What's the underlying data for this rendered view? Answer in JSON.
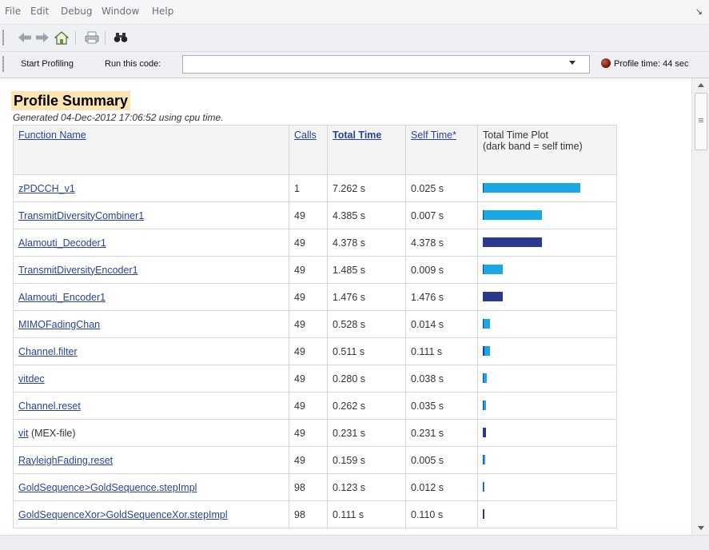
{
  "menu": [
    "File",
    "Edit",
    "Debug",
    "Window",
    "Help"
  ],
  "toolbar": {
    "icons": [
      "back-arrow-icon",
      "forward-arrow-icon",
      "home-icon",
      "print-icon",
      "find-binoculars-icon"
    ]
  },
  "profiler_bar": {
    "start_label": "Start Profiling",
    "run_label": "Run this code:",
    "run_value": "",
    "profile_time": "Profile time: 44 sec"
  },
  "summary": {
    "title": "Profile Summary",
    "generated": "Generated 04-Dec-2012 17:06:52 using cpu time.",
    "headers": {
      "function": "Function Name",
      "calls": "Calls",
      "total": "Total Time",
      "self": "Self Time*",
      "plot_line1": "Total Time Plot",
      "plot_line2": "(dark band = self time)"
    },
    "rows": [
      {
        "name": "zPDCCH_v1",
        "suffix": "",
        "calls": "1",
        "total": "7.262 s",
        "self": "0.025 s",
        "total_s": 7.262,
        "self_s": 0.025
      },
      {
        "name": "TransmitDiversityCombiner1",
        "suffix": "",
        "calls": "49",
        "total": "4.385 s",
        "self": "0.007 s",
        "total_s": 4.385,
        "self_s": 0.007
      },
      {
        "name": "Alamouti_Decoder1",
        "suffix": "",
        "calls": "49",
        "total": "4.378 s",
        "self": "4.378 s",
        "total_s": 4.378,
        "self_s": 4.378
      },
      {
        "name": "TransmitDiversityEncoder1",
        "suffix": "",
        "calls": "49",
        "total": "1.485 s",
        "self": "0.009 s",
        "total_s": 1.485,
        "self_s": 0.009
      },
      {
        "name": "Alamouti_Encoder1",
        "suffix": "",
        "calls": "49",
        "total": "1.476 s",
        "self": "1.476 s",
        "total_s": 1.476,
        "self_s": 1.476
      },
      {
        "name": "MIMOFadingChan",
        "suffix": "",
        "calls": "49",
        "total": "0.528 s",
        "self": "0.014 s",
        "total_s": 0.528,
        "self_s": 0.014
      },
      {
        "name": "Channel.filter",
        "suffix": "",
        "calls": "49",
        "total": "0.511 s",
        "self": "0.111 s",
        "total_s": 0.511,
        "self_s": 0.111
      },
      {
        "name": "vitdec",
        "suffix": "",
        "calls": "49",
        "total": "0.280 s",
        "self": "0.038 s",
        "total_s": 0.28,
        "self_s": 0.038
      },
      {
        "name": "Channel.reset",
        "suffix": "",
        "calls": "49",
        "total": "0.262 s",
        "self": "0.035 s",
        "total_s": 0.262,
        "self_s": 0.035
      },
      {
        "name": "vit",
        "suffix": " (MEX-file)",
        "calls": "49",
        "total": "0.231 s",
        "self": "0.231 s",
        "total_s": 0.231,
        "self_s": 0.231
      },
      {
        "name": "RayleighFading.reset",
        "suffix": "",
        "calls": "49",
        "total": "0.159 s",
        "self": "0.005 s",
        "total_s": 0.159,
        "self_s": 0.005
      },
      {
        "name": "GoldSequence>GoldSequence.stepImpl",
        "suffix": "",
        "calls": "98",
        "total": "0.123 s",
        "self": "0.012 s",
        "total_s": 0.123,
        "self_s": 0.012
      },
      {
        "name": "GoldSequenceXor>GoldSequenceXor.stepImpl",
        "suffix": "",
        "calls": "98",
        "total": "0.111 s",
        "self": "0.110 s",
        "total_s": 0.111,
        "self_s": 0.11
      }
    ]
  },
  "colors": {
    "total_bar": "#1aa7e6",
    "self_bar": "#2b3a8f",
    "title_highlight": "#ffe4b3",
    "link": "#27449a"
  }
}
